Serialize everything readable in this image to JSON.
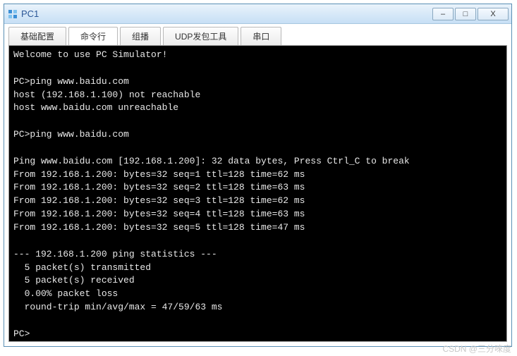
{
  "window": {
    "title": "PC1"
  },
  "tabs": {
    "t0": "基础配置",
    "t1": "命令行",
    "t2": "组播",
    "t3": "UDP发包工具",
    "t4": "串口",
    "active_index": 1
  },
  "win_controls": {
    "minimize": "–",
    "maximize": "□",
    "close": "X"
  },
  "terminal": {
    "lines": [
      "Welcome to use PC Simulator!",
      "",
      "PC>ping www.baidu.com",
      "host (192.168.1.100) not reachable",
      "host www.baidu.com unreachable",
      "",
      "PC>ping www.baidu.com",
      "",
      "Ping www.baidu.com [192.168.1.200]: 32 data bytes, Press Ctrl_C to break",
      "From 192.168.1.200: bytes=32 seq=1 ttl=128 time=62 ms",
      "From 192.168.1.200: bytes=32 seq=2 ttl=128 time=63 ms",
      "From 192.168.1.200: bytes=32 seq=3 ttl=128 time=62 ms",
      "From 192.168.1.200: bytes=32 seq=4 ttl=128 time=63 ms",
      "From 192.168.1.200: bytes=32 seq=5 ttl=128 time=47 ms",
      "",
      "--- 192.168.1.200 ping statistics ---",
      "  5 packet(s) transmitted",
      "  5 packet(s) received",
      "  0.00% packet loss",
      "  round-trip min/avg/max = 47/59/63 ms",
      "",
      "PC>"
    ]
  },
  "watermark": "CSDN @三分唻度"
}
